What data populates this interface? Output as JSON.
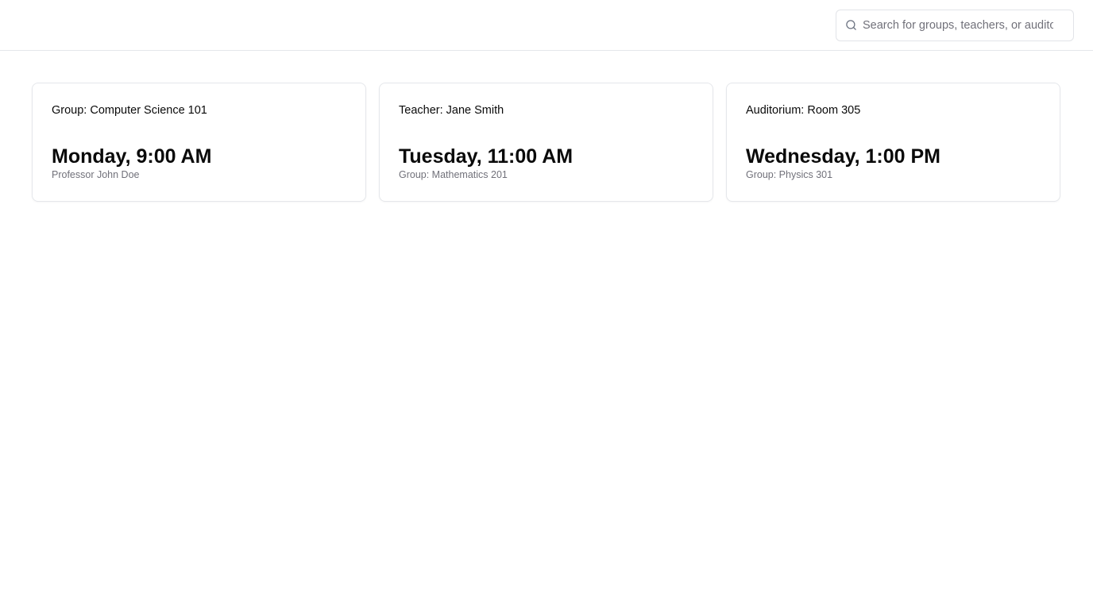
{
  "search": {
    "placeholder": "Search for groups, teachers, or auditoriums",
    "icon": "search-icon"
  },
  "cards": [
    {
      "title": "Group: Computer Science 101",
      "time": "Monday, 9:00 AM",
      "subtitle": "Professor John Doe"
    },
    {
      "title": "Teacher: Jane Smith",
      "time": "Tuesday, 11:00 AM",
      "subtitle": "Group: Mathematics 201"
    },
    {
      "title": "Auditorium: Room 305",
      "time": "Wednesday, 1:00 PM",
      "subtitle": "Group: Physics 301"
    }
  ],
  "colors": {
    "text": "#0a0a0a",
    "muted": "#71717a",
    "border": "#e5e7eb"
  }
}
